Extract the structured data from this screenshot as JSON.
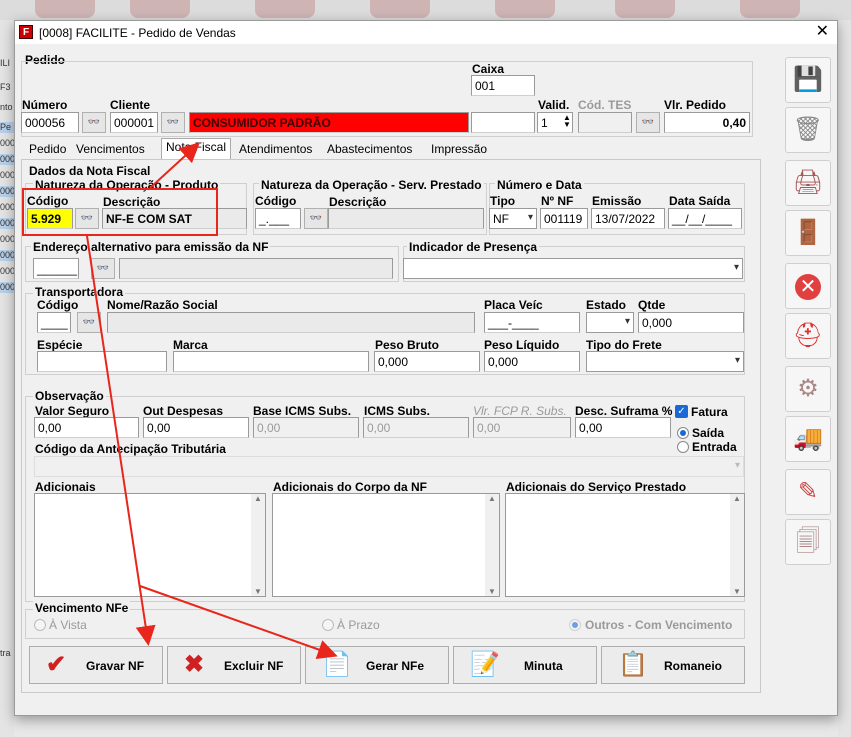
{
  "window": {
    "title": "[0008] FACILITE - Pedido de Vendas",
    "close": "✕"
  },
  "bg_left_rows": [
    "ILI",
    "F3",
    "nto",
    "Pe",
    "000",
    "000",
    "000",
    "000",
    "000",
    "000",
    "000",
    "000",
    "000",
    "000",
    "tra"
  ],
  "pedido": {
    "section": "Pedido",
    "caixa_label": "Caixa",
    "caixa": "001",
    "numero_label": "Número",
    "numero": "000056",
    "cliente_label": "Cliente",
    "cliente_cod": "000001",
    "cliente_nome": "CONSUMIDOR PADRÃO",
    "valid_label": "Valid.",
    "valid": "1",
    "cod_tes_label": "Cód. TES",
    "vlr_label": "Vlr. Pedido",
    "vlr": "0,40"
  },
  "tabs": [
    "Pedido",
    "Vencimentos",
    "Nota Fiscal",
    "Atendimentos",
    "Abastecimentos",
    "Impressão"
  ],
  "nf": {
    "dados_label": "Dados da Nota Fiscal",
    "nat_prod_label": "Natureza da Operação - Produto",
    "codigo_label": "Código",
    "codigo": "5.929",
    "descricao_label": "Descrição",
    "descricao": "NF-E COM SAT",
    "nat_serv_label": "Natureza da Operação - Serv. Prestado",
    "serv_codigo_label": "Código",
    "serv_codigo": "_.___",
    "serv_descricao_label": "Descrição",
    "num_data_label": "Número e Data",
    "tipo_label": "Tipo",
    "tipo": "NF",
    "nnf_label": "Nº NF",
    "nnf": "001119",
    "emissao_label": "Emissão",
    "emissao": "13/07/2022",
    "data_saida_label": "Data Saída",
    "data_saida": "__/__/____",
    "end_alt_label": "Endereço alternativo para emissão da NF",
    "end_alt_cod": "______",
    "ind_pres_label": "Indicador de Presença"
  },
  "transp": {
    "label": "Transportadora",
    "codigo_label": "Código",
    "codigo": "____",
    "nome_label": "Nome/Razão Social",
    "placa_label": "Placa Veíc",
    "placa": "___-____",
    "estado_label": "Estado",
    "qtde_label": "Qtde",
    "qtde": "0,000",
    "especie_label": "Espécie",
    "marca_label": "Marca",
    "peso_bruto_label": "Peso Bruto",
    "peso_bruto": "0,000",
    "peso_liq_label": "Peso Líquido",
    "peso_liq": "0,000",
    "tipo_frete_label": "Tipo do Frete"
  },
  "obs": {
    "label": "Observação",
    "valor_seguro_label": "Valor Seguro",
    "valor_seguro": "0,00",
    "out_desp_label": "Out Despesas",
    "out_desp": "0,00",
    "base_icms_label": "Base ICMS Subs.",
    "base_icms": "0,00",
    "icms_subs_label": "ICMS Subs.",
    "icms_subs": "0,00",
    "fcp_label": "Vlr. FCP R. Subs.",
    "fcp": "0,00",
    "suframa_label": "Desc. Suframa %",
    "suframa": "0,00",
    "fatura_label": "Fatura",
    "saida_label": "Saída",
    "entrada_label": "Entrada",
    "cod_antec_label": "Código da Antecipação Tributária",
    "adicionais_label": "Adicionais",
    "adic_corpo_label": "Adicionais do Corpo da NF",
    "adic_serv_label": "Adicionais do Serviço Prestado"
  },
  "venc": {
    "label": "Vencimento NFe",
    "avista": "À Vista",
    "aprazo": "À Prazo",
    "outros": "Outros - Com Vencimento"
  },
  "buttons": {
    "gravar": "Gravar NF",
    "excluir": "Excluir NF",
    "gerar": "Gerar NFe",
    "minuta": "Minuta",
    "romaneio": "Romaneio"
  },
  "colors": {
    "accent": "#1a6ad6",
    "highlight": "#e8261b",
    "client_bg": "#ff0000",
    "code_bg": "#ffff00"
  }
}
